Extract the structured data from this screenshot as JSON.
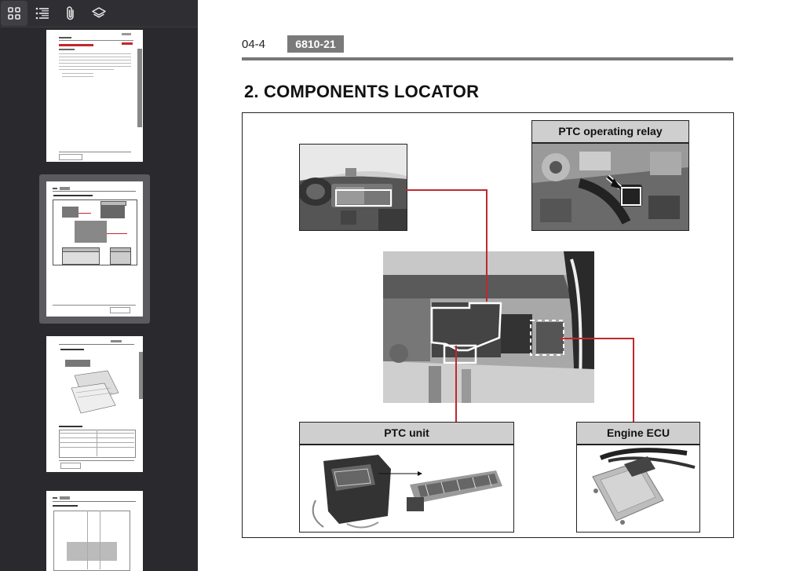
{
  "toolbar": {
    "buttons": [
      {
        "name": "thumbnails-icon"
      },
      {
        "name": "outline-icon"
      },
      {
        "name": "attachments-icon"
      },
      {
        "name": "layers-icon"
      }
    ]
  },
  "thumbnails": [
    {
      "page": 1,
      "selected": false
    },
    {
      "page": 2,
      "selected": true
    },
    {
      "page": 3,
      "selected": false
    },
    {
      "page": 4,
      "selected": false
    }
  ],
  "page": {
    "page_number": "04-4",
    "doc_code": "6810-21",
    "title": "2. COMPONENTS LOCATOR",
    "labels": {
      "relay": "PTC operating relay",
      "ptc_unit": "PTC unit",
      "engine_ecu": "Engine ECU"
    },
    "colors": {
      "callout_line": "#c0282e",
      "caption_bg": "#cfcfcf",
      "header_box": "#7a7a7a"
    }
  }
}
